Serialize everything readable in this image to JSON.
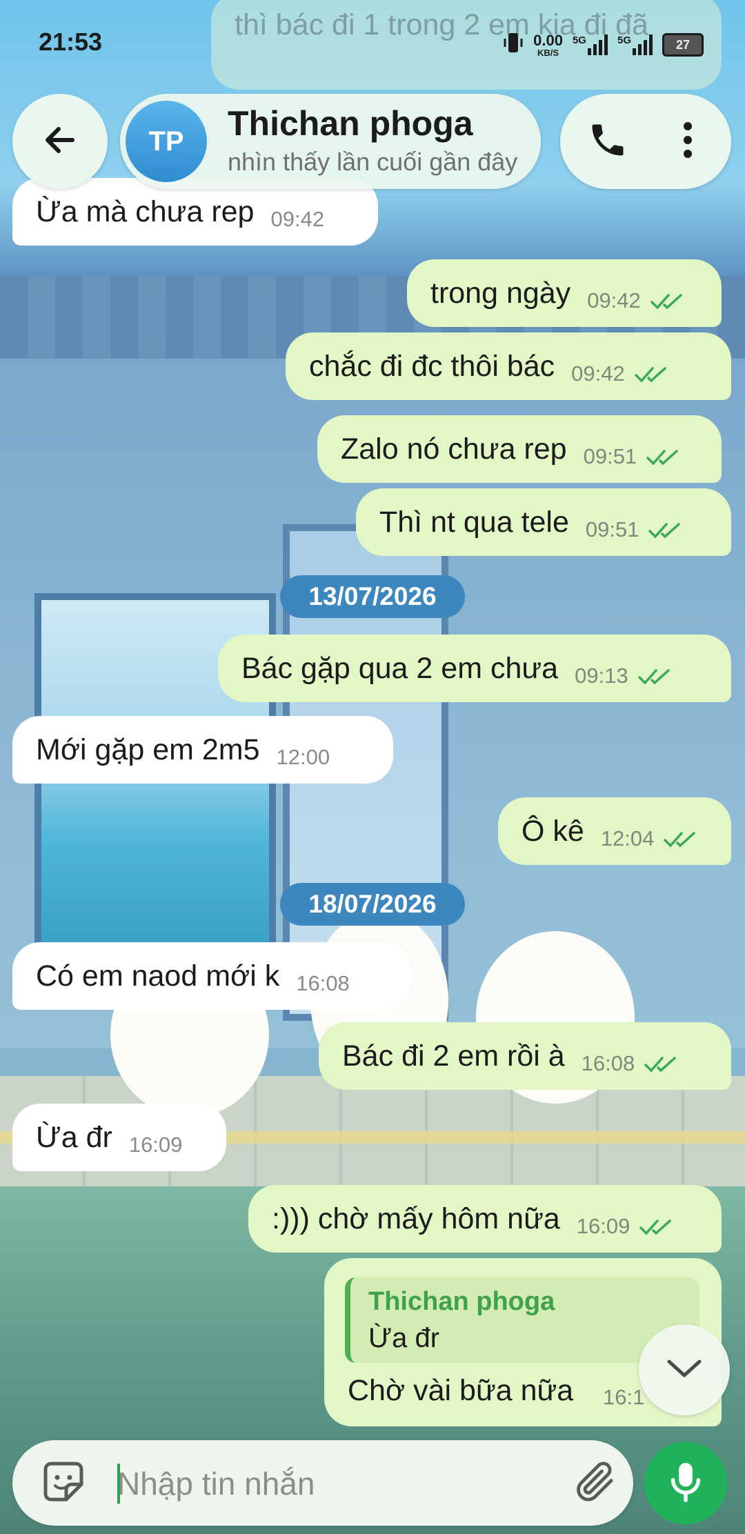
{
  "status_bar": {
    "time": "21:53",
    "net_speed": "0.00",
    "net_unit": "KB/S",
    "sim1": "5G",
    "sim2": "5G",
    "battery": "27"
  },
  "header": {
    "avatar_initials": "TP",
    "contact_name": "Thichan phoga",
    "contact_status": "nhìn thấy lần cuối gần đây"
  },
  "top_ghost_message": "thì bác đi 1 trong 2 em kia đi đã",
  "messages": [
    {
      "dir": "in",
      "text": "Ừa mà chưa rep",
      "time": "09:42"
    },
    {
      "dir": "out",
      "text": "trong ngày",
      "time": "09:42"
    },
    {
      "dir": "out",
      "text": "chắc đi đc thôi bác",
      "time": "09:42"
    },
    {
      "dir": "out",
      "text": "Zalo nó chưa rep",
      "time": "09:51"
    },
    {
      "dir": "out",
      "text": "Thì nt qua tele",
      "time": "09:51"
    },
    {
      "dir": "out",
      "text": "Bác gặp qua 2 em chưa",
      "time": "09:13"
    },
    {
      "dir": "in",
      "text": "Mới gặp em 2m5",
      "time": "12:00"
    },
    {
      "dir": "out",
      "text": "Ô kê",
      "time": "12:04"
    },
    {
      "dir": "in",
      "text": "Có em naod mới k",
      "time": "16:08"
    },
    {
      "dir": "out",
      "text": "Bác đi 2 em rồi à",
      "time": "16:08"
    },
    {
      "dir": "in",
      "text": "Ừa đr",
      "time": "16:09"
    },
    {
      "dir": "out",
      "text": ":))) chờ mấy hôm nữa",
      "time": "16:09"
    }
  ],
  "date_separators": [
    "13/07/2026",
    "18/07/2026"
  ],
  "reply_message": {
    "quoted_name": "Thichan phoga",
    "quoted_text": "Ừa đr",
    "text": "Chờ vài bữa nữa",
    "time": "16:1"
  },
  "composer": {
    "placeholder": "Nhập tin nhắn"
  },
  "colors": {
    "accent": "#21b35b",
    "outgoing_bubble": "#e3f6c6",
    "incoming_bubble": "#ffffff",
    "date_chip": "#3d87bf",
    "read_ticks": "#3aa85a"
  },
  "icons": [
    "back-arrow-icon",
    "phone-icon",
    "more-vert-icon",
    "sticker-icon",
    "paperclip-icon",
    "mic-icon",
    "chevron-down-icon",
    "double-check-icon"
  ]
}
